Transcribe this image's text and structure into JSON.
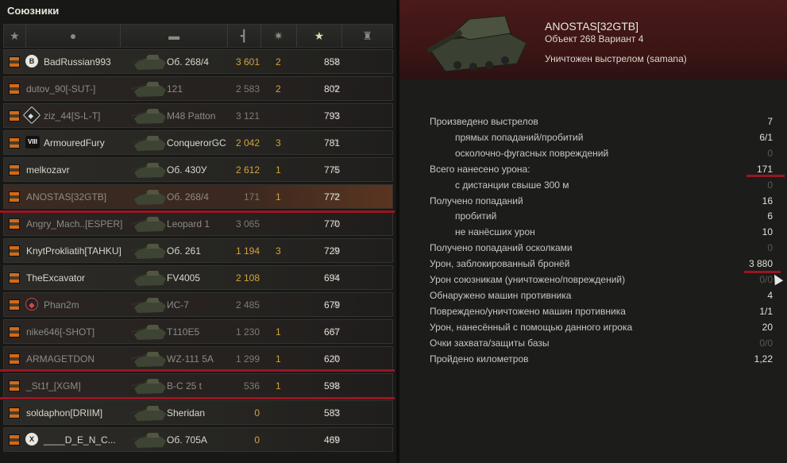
{
  "left_panel": {
    "title": "Союзники",
    "players": [
      {
        "name": "BadRussian993",
        "clan_badge": "B",
        "badge_style": "circle",
        "vehicle": "Об. 268/4",
        "damage": "3 601",
        "kills": "2",
        "xp": "858",
        "dim": false
      },
      {
        "name": "dutov_90[-SUT-]",
        "clan_badge": "",
        "badge_style": "",
        "vehicle": "121",
        "damage": "2 583",
        "kills": "2",
        "xp": "802",
        "dim": true
      },
      {
        "name": "ziz_44[S-L-T]",
        "clan_badge": "◆",
        "badge_style": "diamond",
        "vehicle": "M48 Patton",
        "damage": "3 121",
        "kills": "",
        "xp": "793",
        "dim": true
      },
      {
        "name": "ArmouredFury",
        "clan_badge": "VIII",
        "badge_style": "roman",
        "vehicle": "ConquerorGC",
        "damage": "2 042",
        "kills": "3",
        "xp": "781",
        "dim": false
      },
      {
        "name": "melkozavr",
        "clan_badge": "",
        "badge_style": "",
        "vehicle": "Об. 430У",
        "damage": "2 612",
        "kills": "1",
        "xp": "775",
        "dim": false
      },
      {
        "name": "ANOSTAS[32GTB]",
        "clan_badge": "",
        "badge_style": "",
        "vehicle": "Об. 268/4",
        "damage": "171",
        "kills": "1",
        "xp": "772",
        "dim": true,
        "highlight": true
      },
      {
        "name": "Angry_Mach..[ESPER]",
        "clan_badge": "",
        "badge_style": "",
        "vehicle": "Leopard 1",
        "damage": "3 065",
        "kills": "",
        "xp": "770",
        "dim": true
      },
      {
        "name": "KnytProkliatih[TAHKU]",
        "clan_badge": "",
        "badge_style": "",
        "vehicle": "Об. 261",
        "damage": "1 194",
        "kills": "3",
        "xp": "729",
        "dim": false
      },
      {
        "name": "TheExcavator",
        "clan_badge": "",
        "badge_style": "",
        "vehicle": "FV4005",
        "damage": "2 108",
        "kills": "",
        "xp": "694",
        "dim": false
      },
      {
        "name": "Phan2m",
        "clan_badge": "◆",
        "badge_style": "red",
        "vehicle": "ИС-7",
        "damage": "2 485",
        "kills": "",
        "xp": "679",
        "dim": true
      },
      {
        "name": "nike646[-SHOT]",
        "clan_badge": "",
        "badge_style": "",
        "vehicle": "T110E5",
        "damage": "1 230",
        "kills": "1",
        "xp": "667",
        "dim": true
      },
      {
        "name": "ARMAGETDON",
        "clan_badge": "",
        "badge_style": "",
        "vehicle": "WZ-111 5A",
        "damage": "1 299",
        "kills": "1",
        "xp": "620",
        "dim": true
      },
      {
        "name": "_St1f_[XGM]",
        "clan_badge": "",
        "badge_style": "",
        "vehicle": "B-C 25 t",
        "damage": "536",
        "kills": "1",
        "xp": "598",
        "dim": true
      },
      {
        "name": "soldaphon[DRIIM]",
        "clan_badge": "",
        "badge_style": "",
        "vehicle": "Sheridan",
        "damage": "0",
        "kills": "",
        "xp": "583",
        "dim": false
      },
      {
        "name": "____D_E_N_C...",
        "clan_badge": "X",
        "badge_style": "circle",
        "vehicle": "Об. 705А",
        "damage": "0",
        "kills": "",
        "xp": "469",
        "dim": false
      }
    ]
  },
  "right_panel": {
    "player_name": "ANOSTAS[32GTB]",
    "vehicle_name": "Объект 268 Вариант 4",
    "killed_by": "Уничтожен выстрелом (samana)",
    "stats": [
      {
        "label": "Произведено выстрелов",
        "value": "7",
        "sub": false,
        "zero": false
      },
      {
        "label": "прямых попаданий/пробитий",
        "value": "6/1",
        "sub": true,
        "zero": false
      },
      {
        "label": "осколочно-фугасных повреждений",
        "value": "0",
        "sub": true,
        "zero": true
      },
      {
        "label": "Всего нанесено урона:",
        "value": "171",
        "sub": false,
        "zero": false
      },
      {
        "label": "с дистанции свыше 300 м",
        "value": "0",
        "sub": true,
        "zero": true
      },
      {
        "label": "Получено попаданий",
        "value": "16",
        "sub": false,
        "zero": false
      },
      {
        "label": "пробитий",
        "value": "6",
        "sub": true,
        "zero": false
      },
      {
        "label": "не нанёсших урон",
        "value": "10",
        "sub": true,
        "zero": false
      },
      {
        "label": "Получено попаданий осколками",
        "value": "0",
        "sub": false,
        "zero": true
      },
      {
        "label": "Урон, заблокированный бронёй",
        "value": "3 880",
        "sub": false,
        "zero": false
      },
      {
        "label": "Урон союзникам (уничтожено/повреждений)",
        "value": "0/0",
        "sub": false,
        "zero": true
      },
      {
        "label": "Обнаружено машин противника",
        "value": "4",
        "sub": false,
        "zero": false
      },
      {
        "label": "Повреждено/уничтожено машин противника",
        "value": "1/1",
        "sub": false,
        "zero": false
      },
      {
        "label": "Урон, нанесённый с помощью данного игрока",
        "value": "20",
        "sub": false,
        "zero": false
      },
      {
        "label": "Очки захвата/защиты базы",
        "value": "0/0",
        "sub": false,
        "zero": true
      },
      {
        "label": "Пройдено километров",
        "value": "1,22",
        "sub": false,
        "zero": false
      }
    ]
  },
  "colors": {
    "accent_red": "#9a1522",
    "gold": "#d4a43c",
    "header_bg": "#4a1a1a"
  }
}
